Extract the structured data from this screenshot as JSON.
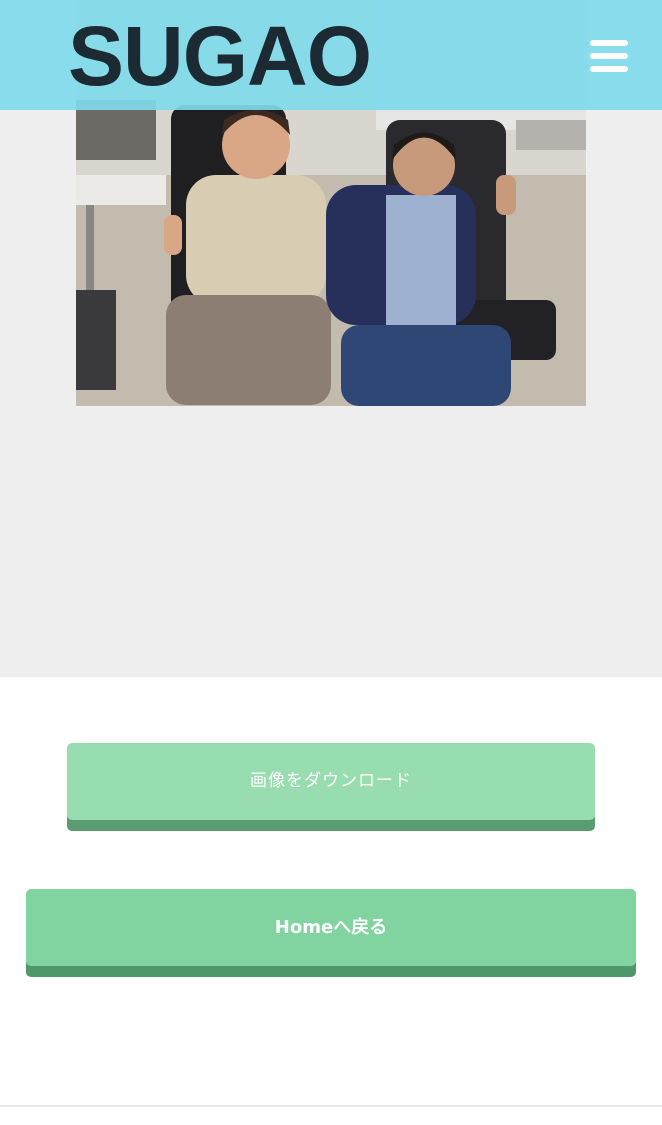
{
  "header": {
    "logo": "SUGAO",
    "menu_icon": "hamburger-menu-icon",
    "background_color": "#80daea"
  },
  "photo": {
    "description_icon": "photo-image"
  },
  "buttons": {
    "download_label": "画像をダウンロード",
    "home_label": "Homeへ戻る",
    "download_color": "#98ddb0",
    "home_color": "#81d4a0"
  }
}
